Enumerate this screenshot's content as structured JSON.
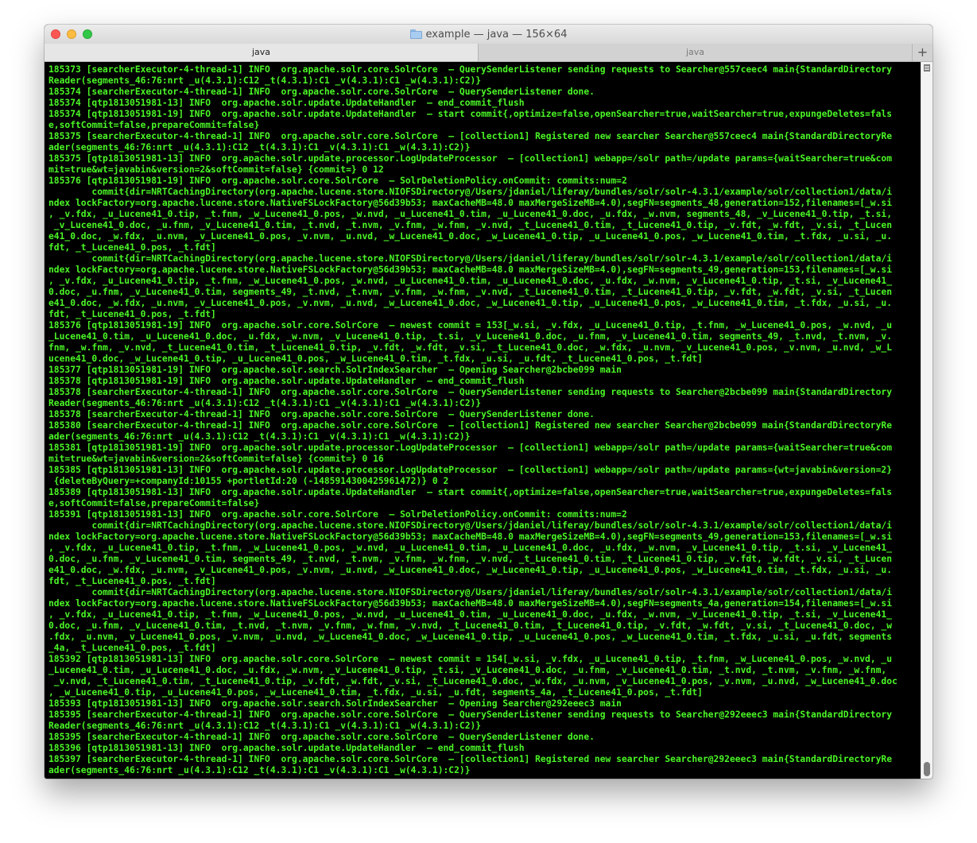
{
  "window": {
    "title": "example — java — 156×64"
  },
  "tabs": [
    {
      "label": "java",
      "active": true
    },
    {
      "label": "java",
      "active": false
    }
  ],
  "tab_add_label": "+",
  "colors": {
    "terminal_bg": "#000000",
    "terminal_fg": "#4af626"
  },
  "terminal": {
    "lines": [
      "185373 [searcherExecutor-4-thread-1] INFO  org.apache.solr.core.SolrCore  – QuerySenderListener sending requests to Searcher@557ceec4 main{StandardDirectory",
      "Reader(segments_46:76:nrt _u(4.3.1):C12 _t(4.3.1):C1 _v(4.3.1):C1 _w(4.3.1):C2)}",
      "185374 [searcherExecutor-4-thread-1] INFO  org.apache.solr.core.SolrCore  – QuerySenderListener done.",
      "185374 [qtp1813051981-13] INFO  org.apache.solr.update.UpdateHandler  – end_commit_flush",
      "185374 [qtp1813051981-19] INFO  org.apache.solr.update.UpdateHandler  – start commit{,optimize=false,openSearcher=true,waitSearcher=true,expungeDeletes=fals",
      "e,softCommit=false,prepareCommit=false}",
      "185375 [searcherExecutor-4-thread-1] INFO  org.apache.solr.core.SolrCore  – [collection1] Registered new searcher Searcher@557ceec4 main{StandardDirectoryRe",
      "ader(segments_46:76:nrt _u(4.3.1):C12 _t(4.3.1):C1 _v(4.3.1):C1 _w(4.3.1):C2)}",
      "185375 [qtp1813051981-13] INFO  org.apache.solr.update.processor.LogUpdateProcessor  – [collection1] webapp=/solr path=/update params={waitSearcher=true&com",
      "mit=true&wt=javabin&version=2&softCommit=false} {commit=} 0 12",
      "185376 [qtp1813051981-19] INFO  org.apache.solr.core.SolrCore  – SolrDeletionPolicy.onCommit: commits:num=2",
      "        commit{dir=NRTCachingDirectory(org.apache.lucene.store.NIOFSDirectory@/Users/jdaniel/liferay/bundles/solr/solr-4.3.1/example/solr/collection1/data/i",
      "ndex lockFactory=org.apache.lucene.store.NativeFSLockFactory@56d39b53; maxCacheMB=48.0 maxMergeSizeMB=4.0),segFN=segments_48,generation=152,filenames=[_w.si",
      ", _v.fdx, _u_Lucene41_0.tip, _t.fnm, _w_Lucene41_0.pos, _w.nvd, _u_Lucene41_0.tim, _u_Lucene41_0.doc, _u.fdx, _w.nvm, segments_48, _v_Lucene41_0.tip, _t.si,",
      " _v_Lucene41_0.doc, _u.fnm, _v_Lucene41_0.tim, _t.nvd, _t.nvm, _v.fnm, _w.fnm, _v.nvd, _t_Lucene41_0.tim, _t_Lucene41_0.tip, _v.fdt, _w.fdt, _v.si, _t_Lucen",
      "e41_0.doc, _w.fdx, _u.nvm, _v_Lucene41_0.pos, _v.nvm, _u.nvd, _w_Lucene41_0.doc, _w_Lucene41_0.tip, _u_Lucene41_0.pos, _w_Lucene41_0.tim, _t.fdx, _u.si, _u.",
      "fdt, _t_Lucene41_0.pos, _t.fdt]",
      "        commit{dir=NRTCachingDirectory(org.apache.lucene.store.NIOFSDirectory@/Users/jdaniel/liferay/bundles/solr/solr-4.3.1/example/solr/collection1/data/i",
      "ndex lockFactory=org.apache.lucene.store.NativeFSLockFactory@56d39b53; maxCacheMB=48.0 maxMergeSizeMB=4.0),segFN=segments_49,generation=153,filenames=[_w.si",
      ", _v.fdx, _u_Lucene41_0.tip, _t.fnm, _w_Lucene41_0.pos, _w.nvd, _u_Lucene41_0.tim, _u_Lucene41_0.doc, _u.fdx, _w.nvm, _v_Lucene41_0.tip, _t.si, _v_Lucene41_",
      "0.doc, _u.fnm, _v_Lucene41_0.tim, segments_49, _t.nvd, _t.nvm, _v.fnm, _w.fnm, _v.nvd, _t_Lucene41_0.tim, _t_Lucene41_0.tip, _v.fdt, _w.fdt, _v.si, _t_Lucen",
      "e41_0.doc, _w.fdx, _u.nvm, _v_Lucene41_0.pos, _v.nvm, _u.nvd, _w_Lucene41_0.doc, _w_Lucene41_0.tip, _u_Lucene41_0.pos, _w_Lucene41_0.tim, _t.fdx, _u.si, _u.",
      "fdt, _t_Lucene41_0.pos, _t.fdt]",
      "185376 [qtp1813051981-19] INFO  org.apache.solr.core.SolrCore  – newest commit = 153[_w.si, _v.fdx, _u_Lucene41_0.tip, _t.fnm, _w_Lucene41_0.pos, _w.nvd, _u",
      "_Lucene41_0.tim, _u_Lucene41_0.doc, _u.fdx, _w.nvm, _v_Lucene41_0.tip, _t.si, _v_Lucene41_0.doc, _u.fnm, _v_Lucene41_0.tim, segments_49, _t.nvd, _t.nvm, _v.",
      "fnm, _w.fnm, _v.nvd, _t_Lucene41_0.tim, _t_Lucene41_0.tip, _v.fdt, _w.fdt, _v.si, _t_Lucene41_0.doc, _w.fdx, _u.nvm, _v_Lucene41_0.pos, _v.nvm, _u.nvd, _w_L",
      "ucene41_0.doc, _w_Lucene41_0.tip, _u_Lucene41_0.pos, _w_Lucene41_0.tim, _t.fdx, _u.si, _u.fdt, _t_Lucene41_0.pos, _t.fdt]",
      "185377 [qtp1813051981-19] INFO  org.apache.solr.search.SolrIndexSearcher  – Opening Searcher@2bcbe099 main",
      "185378 [qtp1813051981-19] INFO  org.apache.solr.update.UpdateHandler  – end_commit_flush",
      "185378 [searcherExecutor-4-thread-1] INFO  org.apache.solr.core.SolrCore  – QuerySenderListener sending requests to Searcher@2bcbe099 main{StandardDirectory",
      "Reader(segments_46:76:nrt _u(4.3.1):C12 _t(4.3.1):C1 _v(4.3.1):C1 _w(4.3.1):C2)}",
      "185378 [searcherExecutor-4-thread-1] INFO  org.apache.solr.core.SolrCore  – QuerySenderListener done.",
      "185380 [searcherExecutor-4-thread-1] INFO  org.apache.solr.core.SolrCore  – [collection1] Registered new searcher Searcher@2bcbe099 main{StandardDirectoryRe",
      "ader(segments_46:76:nrt _u(4.3.1):C12 _t(4.3.1):C1 _v(4.3.1):C1 _w(4.3.1):C2)}",
      "185381 [qtp1813051981-19] INFO  org.apache.solr.update.processor.LogUpdateProcessor  – [collection1] webapp=/solr path=/update params={waitSearcher=true&com",
      "mit=true&wt=javabin&version=2&softCommit=false} {commit=} 0 16",
      "185385 [qtp1813051981-13] INFO  org.apache.solr.update.processor.LogUpdateProcessor  – [collection1] webapp=/solr path=/update params={wt=javabin&version=2}",
      " {deleteByQuery=+companyId:10155 +portletId:20 (-1485914300425961472)} 0 2",
      "185389 [qtp1813051981-13] INFO  org.apache.solr.update.UpdateHandler  – start commit{,optimize=false,openSearcher=true,waitSearcher=true,expungeDeletes=fals",
      "e,softCommit=false,prepareCommit=false}",
      "185391 [qtp1813051981-13] INFO  org.apache.solr.core.SolrCore  – SolrDeletionPolicy.onCommit: commits:num=2",
      "        commit{dir=NRTCachingDirectory(org.apache.lucene.store.NIOFSDirectory@/Users/jdaniel/liferay/bundles/solr/solr-4.3.1/example/solr/collection1/data/i",
      "ndex lockFactory=org.apache.lucene.store.NativeFSLockFactory@56d39b53; maxCacheMB=48.0 maxMergeSizeMB=4.0),segFN=segments_49,generation=153,filenames=[_w.si",
      ", _v.fdx, _u_Lucene41_0.tip, _t.fnm, _w_Lucene41_0.pos, _w.nvd, _u_Lucene41_0.tim, _u_Lucene41_0.doc, _u.fdx, _w.nvm, _v_Lucene41_0.tip, _t.si, _v_Lucene41_",
      "0.doc, _u.fnm, _v_Lucene41_0.tim, segments_49, _t.nvd, _t.nvm, _v.fnm, _w.fnm, _v.nvd, _t_Lucene41_0.tim, _t_Lucene41_0.tip, _v.fdt, _w.fdt, _v.si, _t_Lucen",
      "e41_0.doc, _w.fdx, _u.nvm, _v_Lucene41_0.pos, _v.nvm, _u.nvd, _w_Lucene41_0.doc, _w_Lucene41_0.tip, _u_Lucene41_0.pos, _w_Lucene41_0.tim, _t.fdx, _u.si, _u.",
      "fdt, _t_Lucene41_0.pos, _t.fdt]",
      "        commit{dir=NRTCachingDirectory(org.apache.lucene.store.NIOFSDirectory@/Users/jdaniel/liferay/bundles/solr/solr-4.3.1/example/solr/collection1/data/i",
      "ndex lockFactory=org.apache.lucene.store.NativeFSLockFactory@56d39b53; maxCacheMB=48.0 maxMergeSizeMB=4.0),segFN=segments_4a,generation=154,filenames=[_w.si",
      ", _v.fdx, _u_Lucene41_0.tip, _t.fnm, _w_Lucene41_0.pos, _w.nvd, _u_Lucene41_0.tim, _u_Lucene41_0.doc, _u.fdx, _w.nvm, _v_Lucene41_0.tip, _t.si, _v_Lucene41_",
      "0.doc, _u.fnm, _v_Lucene41_0.tim, _t.nvd, _t.nvm, _v.fnm, _w.fnm, _v.nvd, _t_Lucene41_0.tim, _t_Lucene41_0.tip, _v.fdt, _w.fdt, _v.si, _t_Lucene41_0.doc, _w",
      ".fdx, _u.nvm, _v_Lucene41_0.pos, _v.nvm, _u.nvd, _w_Lucene41_0.doc, _w_Lucene41_0.tip, _u_Lucene41_0.pos, _w_Lucene41_0.tim, _t.fdx, _u.si, _u.fdt, segments",
      "_4a, _t_Lucene41_0.pos, _t.fdt]",
      "185392 [qtp1813051981-13] INFO  org.apache.solr.core.SolrCore  – newest commit = 154[_w.si, _v.fdx, _u_Lucene41_0.tip, _t.fnm, _w_Lucene41_0.pos, _w.nvd, _u",
      "_Lucene41_0.tim, _u_Lucene41_0.doc, _u.fdx, _w.nvm, _v_Lucene41_0.tip, _t.si, _v_Lucene41_0.doc, _u.fnm, _v_Lucene41_0.tim, _t.nvd, _t.nvm, _v.fnm, _w.fnm,",
      " _v.nvd, _t_Lucene41_0.tim, _t_Lucene41_0.tip, _v.fdt, _w.fdt, _v.si, _t_Lucene41_0.doc, _w.fdx, _u.nvm, _v_Lucene41_0.pos, _v.nvm, _u.nvd, _w_Lucene41_0.doc",
      ", _w_Lucene41_0.tip, _u_Lucene41_0.pos, _w_Lucene41_0.tim, _t.fdx, _u.si, _u.fdt, segments_4a, _t_Lucene41_0.pos, _t.fdt]",
      "185393 [qtp1813051981-13] INFO  org.apache.solr.search.SolrIndexSearcher  – Opening Searcher@292eeec3 main",
      "185395 [searcherExecutor-4-thread-1] INFO  org.apache.solr.core.SolrCore  – QuerySenderListener sending requests to Searcher@292eeec3 main{StandardDirectory",
      "Reader(segments_46:76:nrt _u(4.3.1):C12 _t(4.3.1):C1 _v(4.3.1):C1 _w(4.3.1):C2)}",
      "185395 [searcherExecutor-4-thread-1] INFO  org.apache.solr.core.SolrCore  – QuerySenderListener done.",
      "185396 [qtp1813051981-13] INFO  org.apache.solr.update.UpdateHandler  – end_commit_flush",
      "185397 [searcherExecutor-4-thread-1] INFO  org.apache.solr.core.SolrCore  – [collection1] Registered new searcher Searcher@292eeec3 main{StandardDirectoryRe",
      "ader(segments_46:76:nrt _u(4.3.1):C12 _t(4.3.1):C1 _v(4.3.1):C1 _w(4.3.1):C2)}"
    ]
  },
  "scrollbar": {
    "position_fraction": 1.0
  }
}
